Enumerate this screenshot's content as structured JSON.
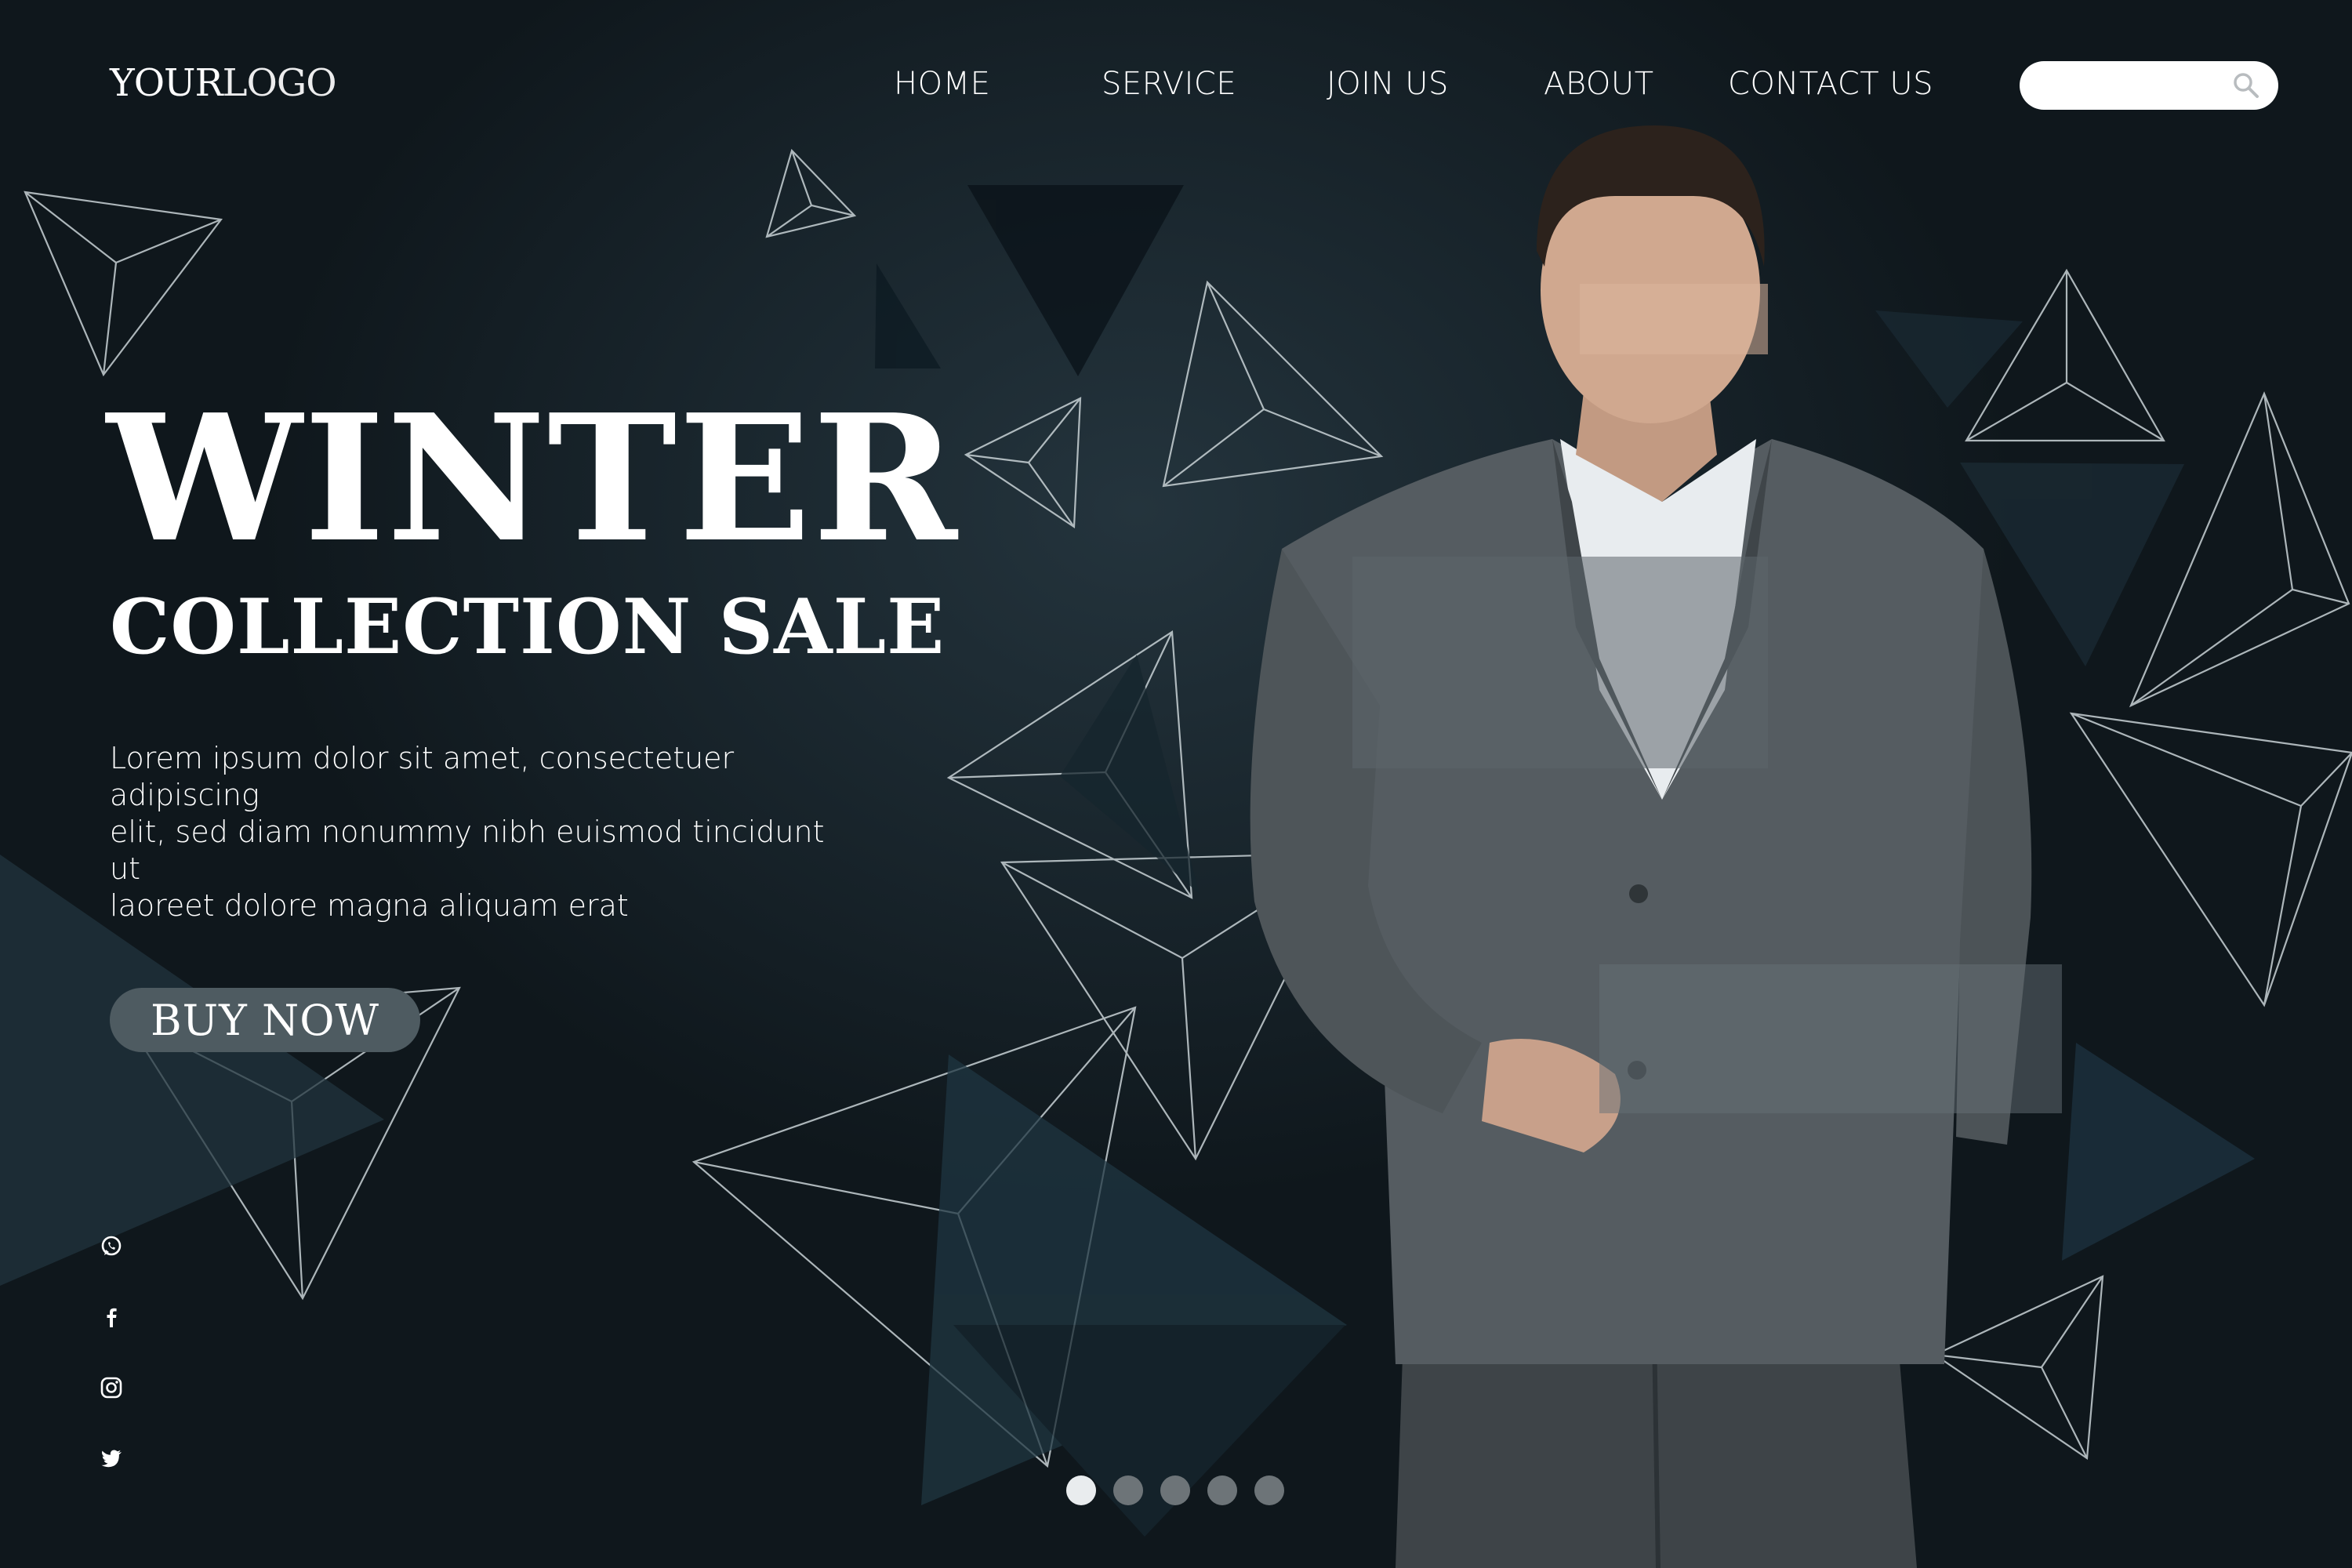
{
  "logo": {
    "bold": "YOUR",
    "thin": "LOGO"
  },
  "nav": {
    "items": [
      {
        "label": "HOME"
      },
      {
        "label": "SERVICE"
      },
      {
        "label": "JOIN US"
      },
      {
        "label": "ABOUT"
      },
      {
        "label": "CONTACT US"
      }
    ]
  },
  "search": {
    "value": "",
    "placeholder": "",
    "icon": "search-icon"
  },
  "hero": {
    "title": "WINTER",
    "subtitle": "COLLECTION SALE",
    "body_lines": [
      "Lorem ipsum dolor sit amet, consectetuer adipiscing",
      "elit, sed diam nonummy nibh euismod tincidunt ut",
      "laoreet dolore magna aliquam erat"
    ],
    "cta_label": "BUY NOW"
  },
  "social": [
    "whatsapp-icon",
    "facebook-icon",
    "instagram-icon",
    "twitter-icon"
  ],
  "carousel": {
    "slide_count": 5,
    "active_index": 0
  },
  "colors": {
    "background": "#101a20",
    "button": "#4e5b61",
    "dot_active": "#e9ecee",
    "dot_inactive": "#6d7478"
  }
}
